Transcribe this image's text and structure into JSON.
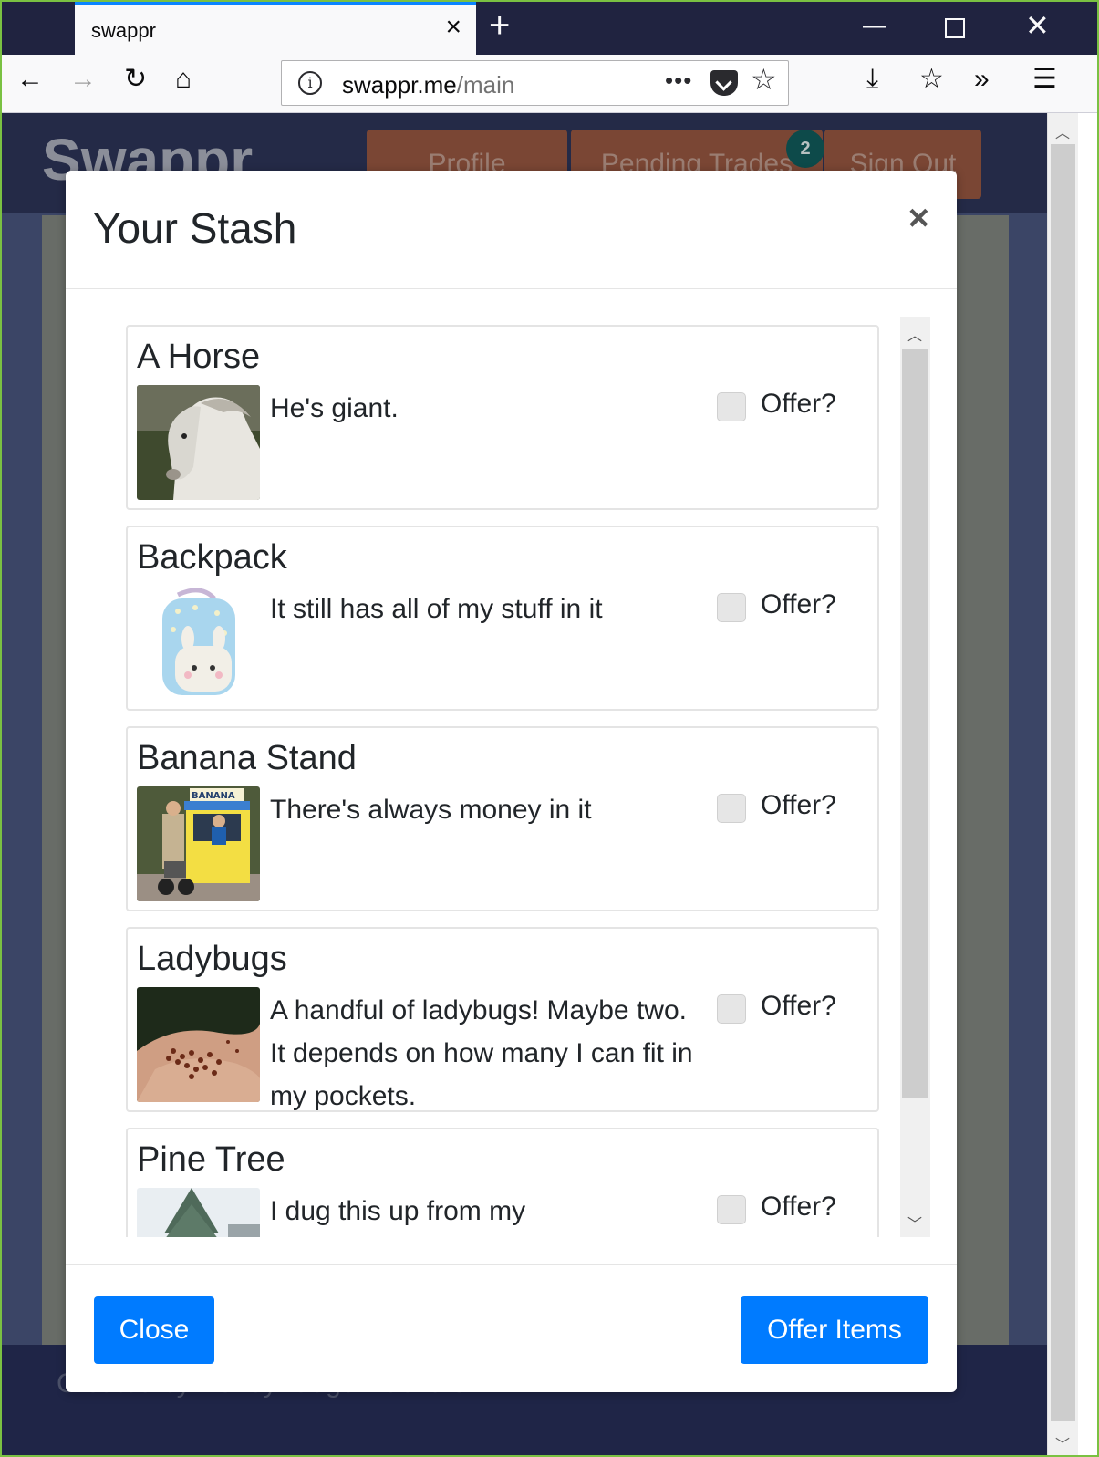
{
  "browser": {
    "tab_title": "swappr",
    "url_host": "swappr.me",
    "url_path": "/main"
  },
  "page": {
    "brand": "Swappr",
    "nav": {
      "profile": "Profile",
      "pending_trades": "Pending Trades",
      "pending_count": "2",
      "sign_out": "Sign Out"
    },
    "footer": "Created by HoneyBadgerHackers"
  },
  "modal": {
    "title": "Your Stash",
    "close_symbol": "×",
    "items": [
      {
        "title": "A Horse",
        "description": "He's giant.",
        "offer_label": "Offer?",
        "offered": false
      },
      {
        "title": "Backpack",
        "description": "It still has all of my stuff in it",
        "offer_label": "Offer?",
        "offered": false
      },
      {
        "title": "Banana Stand",
        "description": "There's always money in it",
        "offer_label": "Offer?",
        "offered": false
      },
      {
        "title": "Ladybugs",
        "description": "A handful of ladybugs! Maybe two. It depends on how many I can fit in my pockets.",
        "offer_label": "Offer?",
        "offered": false
      },
      {
        "title": "Pine Tree",
        "description": "I dug this up from my",
        "offer_label": "Offer?",
        "offered": false
      }
    ],
    "close_button": "Close",
    "offer_button": "Offer Items"
  }
}
